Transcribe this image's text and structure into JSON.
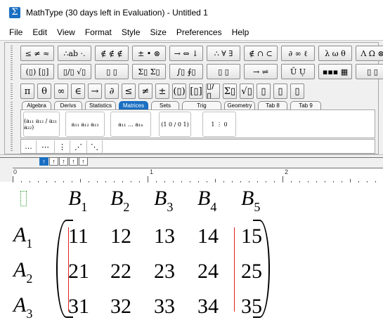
{
  "window": {
    "title": "MathType (30 days left in Evaluation) - Untitled 1"
  },
  "menu": [
    "File",
    "Edit",
    "View",
    "Format",
    "Style",
    "Size",
    "Preferences",
    "Help"
  ],
  "palette_row1": [
    "≤ ≠ ≈",
    "∴ab ·.",
    "∉ ∉ ∉",
    "± • ⊗",
    "→ ⇔ ↓",
    "∴ ∀ ∃",
    "∉ ∩ ⊂",
    "∂ ∞ ℓ",
    "λ ω θ",
    "Λ Ω ⊗"
  ],
  "palette_row2": [
    "(▯) [▯]",
    "▯/▯ √▯",
    "▯ ▯",
    "Σ▯ Σ▯",
    "∫▯ ∮▯",
    "▯ ▯",
    "→ ⇌",
    "Ū Ụ",
    "▪▪▪ ▦",
    "▯ ▯"
  ],
  "symbols": [
    "π",
    "θ",
    "∞",
    "∈",
    "→",
    "∂",
    "≤",
    "≠",
    "±",
    "(▯)",
    "[▯]",
    "▯/▯",
    "Σ▯",
    "√▯",
    "▯",
    "▯",
    "▯"
  ],
  "tabs": [
    {
      "label": "Algebra",
      "active": false
    },
    {
      "label": "Derivs",
      "active": false
    },
    {
      "label": "Statistics",
      "active": false
    },
    {
      "label": "Matrices",
      "active": true
    },
    {
      "label": "Sets",
      "active": false
    },
    {
      "label": "Trig",
      "active": false
    },
    {
      "label": "Geometry",
      "active": false
    },
    {
      "label": "Tab 8",
      "active": false
    },
    {
      "label": "Tab 9",
      "active": false
    }
  ],
  "templates": [
    "(a₁₁ a₁₂ / a₂₁ a₂₂)",
    "a₁₁ a₁₂ a₁₃",
    "a₁₁ … a₁ₙ",
    "(1 0 / 0 1)",
    "1 ⋮ 0"
  ],
  "small_templates": [
    "…",
    "⋯",
    "⋮",
    "⋰",
    "⋱"
  ],
  "ruler": {
    "labels": [
      "0",
      "1",
      "2"
    ],
    "tab_buttons": [
      "↑",
      "↑",
      "↑",
      "↑",
      "↑"
    ]
  },
  "equation": {
    "col_headers": [
      {
        "v": "B",
        "s": "1"
      },
      {
        "v": "B",
        "s": "2"
      },
      {
        "v": "B",
        "s": "3"
      },
      {
        "v": "B",
        "s": "4"
      },
      {
        "v": "B",
        "s": "5"
      }
    ],
    "row_headers": [
      {
        "v": "A",
        "s": "1"
      },
      {
        "v": "A",
        "s": "2"
      },
      {
        "v": "A",
        "s": "3"
      }
    ],
    "matrix": [
      [
        "11",
        "12",
        "13",
        "14",
        "15"
      ],
      [
        "21",
        "22",
        "23",
        "24",
        "25"
      ],
      [
        "31",
        "32",
        "33",
        "34",
        "35"
      ]
    ]
  },
  "colors": {
    "accent": "#1a6fc2",
    "divider": "#e02020",
    "placeholder": "#2a9b2a"
  }
}
